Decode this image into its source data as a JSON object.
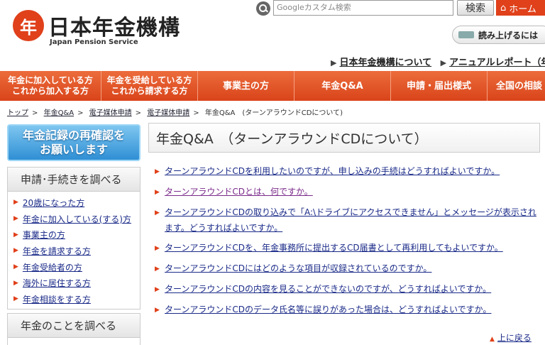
{
  "header": {
    "logo_mark": "年",
    "logo_ja": "日本年金機構",
    "logo_en": "Japan Pension Service",
    "search_placeholder": "Googleカスタム検索",
    "search_button": "検索",
    "home_label": "ホーム",
    "read_aloud": "読み上げるには",
    "top_links": [
      "日本年金機構について",
      "アニュアルレポート（年"
    ]
  },
  "nav": {
    "items": [
      {
        "line1": "年金に加入している方",
        "line2": "これから加入する方"
      },
      {
        "line1": "年金を受給している方",
        "line2": "これから請求する方"
      },
      {
        "label": "事業主の方"
      },
      {
        "label": "年金Q&A"
      },
      {
        "label": "申請・届出様式"
      },
      {
        "label": "全国の相談・手"
      }
    ]
  },
  "breadcrumb": {
    "items": [
      "トップ",
      "年金Q&A",
      "電子媒体申請",
      "電子媒体申請",
      "年金Q&A　(ターンアラウンドCDについて)"
    ]
  },
  "sidebar": {
    "banner_line1": "年金記録の再確認を",
    "banner_line2": "お願いします",
    "section1_title": "申請･手続きを調べる",
    "section1_items": [
      "20歳になった方",
      "年金に加入している(する)方",
      "事業主の方",
      "年金を請求する方",
      "年金受給者の方",
      "海外に居住する方",
      "年金相談をする方"
    ],
    "section2_title": "年金のことを調べる"
  },
  "main": {
    "title": "年金Q&A　（ターンアラウンドCDについて）",
    "questions": [
      "ターンアラウンドCDを利用したいのですが、申し込みの手続はどうすればよいですか。",
      "ターンアラウンドCDとは、何ですか。",
      "ターンアラウンドCDの取り込みで「A:\\ドライブにアクセスできません」とメッセージが表示されます。どうすればよいですか。",
      "ターンアラウンドCDを、年金事務所に提出するCD届書として再利用してもよいですか。",
      "ターンアラウンドCDにはどのような項目が収録されているのですか。",
      "ターンアラウンドCDの内容を見ることができないのですが、どうすればよいですか。",
      "ターンアラウンドCDのデータ氏名等に誤りがあった場合は、どうすればよいですか。"
    ],
    "to_top": "上に戻る"
  }
}
